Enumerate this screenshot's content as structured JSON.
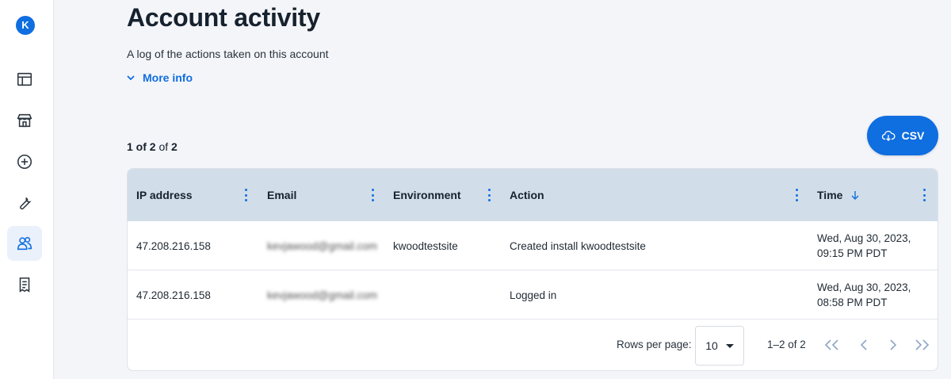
{
  "sidebar": {
    "logo_letter": "K",
    "items": [
      {
        "name": "layout-icon"
      },
      {
        "name": "store-icon"
      },
      {
        "name": "add-circle-icon"
      },
      {
        "name": "wrench-icon"
      },
      {
        "name": "users-icon",
        "active": true
      },
      {
        "name": "receipt-icon"
      }
    ]
  },
  "header": {
    "title": "Account activity",
    "subtitle": "A log of the actions taken on this account",
    "more_info_label": "More info"
  },
  "results": {
    "shown": "1 of 2",
    "of_label": "of",
    "total": "2"
  },
  "csv_button": {
    "label": "CSV",
    "icon": "cloud-download-icon"
  },
  "table": {
    "columns": [
      {
        "key": "ip",
        "label": "IP address"
      },
      {
        "key": "email",
        "label": "Email"
      },
      {
        "key": "environment",
        "label": "Environment"
      },
      {
        "key": "action",
        "label": "Action"
      },
      {
        "key": "time",
        "label": "Time",
        "sort": "descending"
      }
    ],
    "rows": [
      {
        "ip": "47.208.216.158",
        "email": "kevjawood@gmail.com",
        "environment": "kwoodtestsite",
        "action": "Created install kwoodtestsite",
        "time_line1": "Wed, Aug 30, 2023,",
        "time_line2": "09:15 PM PDT"
      },
      {
        "ip": "47.208.216.158",
        "email": "kevjawood@gmail.com",
        "environment": "",
        "action": "Logged in",
        "time_line1": "Wed, Aug 30, 2023,",
        "time_line2": "08:58 PM PDT"
      }
    ]
  },
  "pagination": {
    "rows_per_page_label": "Rows per page:",
    "rows_per_page_value": "10",
    "range_label": "1–2 of 2"
  },
  "colors": {
    "accent": "#0f6ee0",
    "header_bg": "#d1dee9",
    "page_bg": "#f4f5f9"
  }
}
